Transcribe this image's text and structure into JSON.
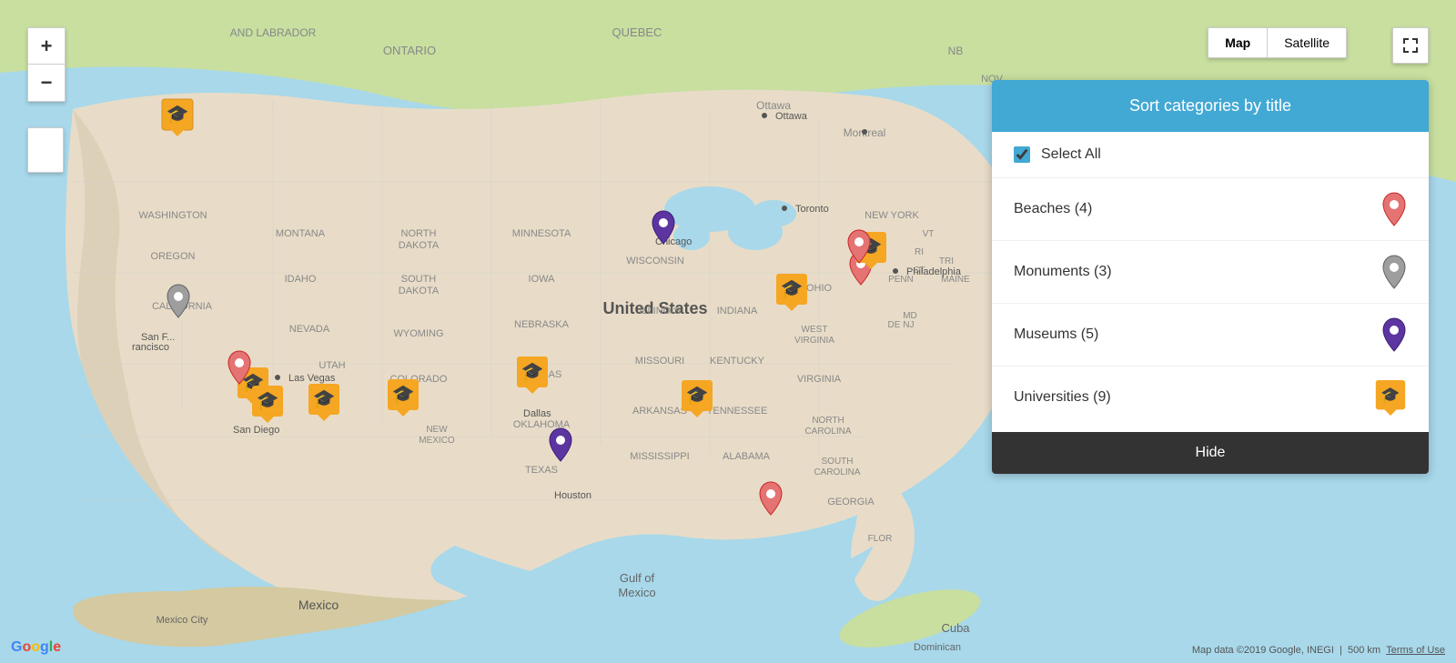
{
  "map": {
    "type_toggle": {
      "map_label": "Map",
      "satellite_label": "Satellite",
      "active": "Map"
    },
    "zoom_in_label": "+",
    "zoom_out_label": "−",
    "footer": {
      "attribution": "Map data ©2019 Google, INEGI",
      "scale": "500 km",
      "terms": "Terms of Use"
    },
    "google_logo": "Google"
  },
  "filter_panel": {
    "title": "Sort categories by title",
    "select_all_label": "Select All",
    "select_all_checked": true,
    "categories": [
      {
        "name": "Beaches",
        "count": 4,
        "label": "Beaches (4)",
        "pin_type": "pink"
      },
      {
        "name": "Monuments",
        "count": 3,
        "label": "Monuments (3)",
        "pin_type": "gray"
      },
      {
        "name": "Museums",
        "count": 5,
        "label": "Museums (5)",
        "pin_type": "purple"
      },
      {
        "name": "Universities",
        "count": 9,
        "label": "Universities (9)",
        "pin_type": "orange"
      }
    ],
    "hide_button_label": "Hide"
  },
  "markers": {
    "universities": [
      {
        "left": "195",
        "top": "148",
        "label": ""
      },
      {
        "left": "267",
        "top": "424",
        "label": ""
      },
      {
        "left": "280",
        "top": "448",
        "label": ""
      },
      {
        "left": "355",
        "top": "467",
        "label": ""
      },
      {
        "left": "443",
        "top": "462",
        "label": ""
      },
      {
        "left": "583",
        "top": "438",
        "label": ""
      },
      {
        "left": "764",
        "top": "462",
        "label": ""
      },
      {
        "left": "870",
        "top": "344",
        "label": ""
      },
      {
        "left": "956",
        "top": "298",
        "label": ""
      }
    ],
    "beaches_pink": [
      {
        "left": "843",
        "top": "572"
      },
      {
        "left": "946",
        "top": "292"
      },
      {
        "left": "265",
        "top": "428"
      }
    ],
    "monuments_gray": [
      {
        "left": "195",
        "top": "355"
      }
    ],
    "museums_purple": [
      {
        "left": "727",
        "top": "272"
      },
      {
        "left": "616",
        "top": "510"
      }
    ]
  },
  "city_labels": [
    {
      "text": "Washington",
      "left": "215",
      "top": "165"
    },
    {
      "text": "San Francisco",
      "left": "180",
      "top": "375"
    },
    {
      "text": "San Diego",
      "left": "270",
      "top": "470"
    },
    {
      "text": "Las Vegas",
      "left": "305",
      "top": "415"
    },
    {
      "text": "Dallas",
      "left": "575",
      "top": "455"
    },
    {
      "text": "Houston",
      "left": "616",
      "top": "545"
    },
    {
      "text": "Chicago",
      "left": "718",
      "top": "290"
    }
  ]
}
